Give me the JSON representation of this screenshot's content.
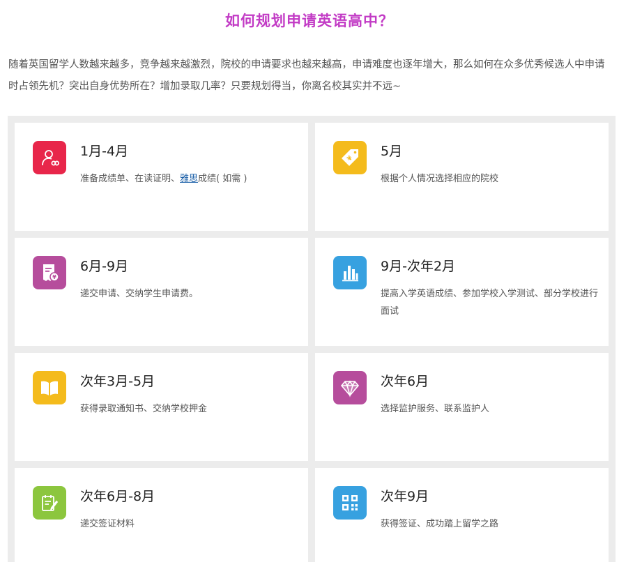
{
  "page": {
    "title": "如何规划申请英语高中？",
    "intro": "随着英国留学人数越来越多，竞争越来越激烈，院校的申请要求也越来越高，申请难度也逐年增大，那么如何在众多优秀候选人中申请时占领先机？突出自身优势所在？增加录取几率？只要规划得当，你离名校其实并不远~"
  },
  "cards": [
    {
      "title": "1月-4月",
      "desc_before": "准备成绩单、在读证明、",
      "desc_link": "雅思",
      "desc_after": "成绩( 如需 )",
      "icon": "user-card-icon",
      "color": "#e8264a"
    },
    {
      "title": "5月",
      "desc": "根据个人情况选择相应的院校",
      "icon": "price-tag-icon",
      "color": "#f4bb1c"
    },
    {
      "title": "6月-9月",
      "desc": "递交申请、交纳学生申请费。",
      "icon": "receipt-icon",
      "color": "#b64d9c"
    },
    {
      "title": "9月-次年2月",
      "desc": "提高入学英语成绩、参加学校入学测试、部分学校进行面试",
      "icon": "bar-chart-icon",
      "color": "#37a1e0"
    },
    {
      "title": "次年3月-5月",
      "desc": "获得录取通知书、交纳学校押金",
      "icon": "book-icon",
      "color": "#f4bb1c"
    },
    {
      "title": "次年6月",
      "desc": "选择监护服务、联系监护人",
      "icon": "diamond-icon",
      "color": "#b64d9c"
    },
    {
      "title": "次年6月-8月",
      "desc": "递交签证材料",
      "icon": "edit-note-icon",
      "color": "#8cc63e"
    },
    {
      "title": "次年9月",
      "desc": "获得签证、成功踏上留学之路",
      "icon": "qr-code-icon",
      "color": "#37a1e0"
    }
  ]
}
